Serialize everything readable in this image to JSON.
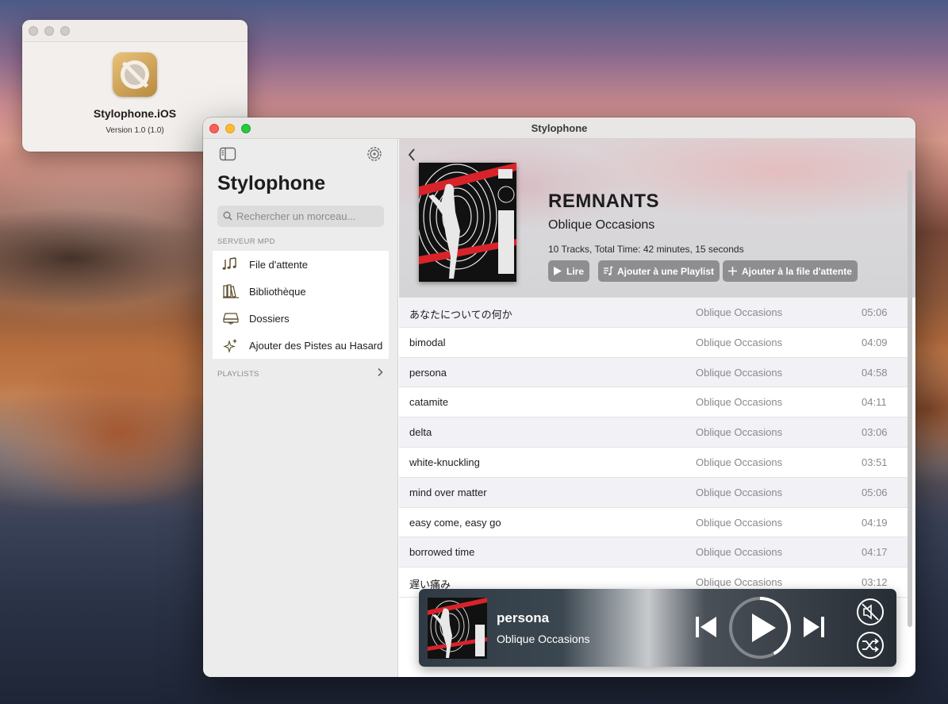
{
  "about": {
    "app_name": "Stylophone.iOS",
    "version": "Version 1.0 (1.0)"
  },
  "window": {
    "title": "Stylophone"
  },
  "sidebar": {
    "title": "Stylophone",
    "search_placeholder": "Rechercher un morceau...",
    "server_section": "SERVEUR MPD",
    "items": [
      {
        "label": "File d'attente",
        "icon": "music-notes-icon"
      },
      {
        "label": "Bibliothèque",
        "icon": "books-icon"
      },
      {
        "label": "Dossiers",
        "icon": "drive-icon"
      },
      {
        "label": "Ajouter des Pistes au Hasard",
        "icon": "sparkles-icon"
      }
    ],
    "playlists_section": "PLAYLISTS"
  },
  "album": {
    "title": "REMNANTS",
    "artist": "Oblique Occasions",
    "meta": "10 Tracks, Total Time: 42 minutes, 15 seconds",
    "buttons": {
      "play": "Lire",
      "add_playlist": "Ajouter à une Playlist",
      "add_queue": "Ajouter à la file d'attente"
    }
  },
  "tracks": [
    {
      "title": "あなたについての何か",
      "artist": "Oblique Occasions",
      "duration": "05:06"
    },
    {
      "title": "bimodal",
      "artist": "Oblique Occasions",
      "duration": "04:09"
    },
    {
      "title": "persona",
      "artist": "Oblique Occasions",
      "duration": "04:58"
    },
    {
      "title": "catamite",
      "artist": "Oblique Occasions",
      "duration": "04:11"
    },
    {
      "title": "delta",
      "artist": "Oblique Occasions",
      "duration": "03:06"
    },
    {
      "title": "white-knuckling",
      "artist": "Oblique Occasions",
      "duration": "03:51"
    },
    {
      "title": "mind over matter",
      "artist": "Oblique Occasions",
      "duration": "05:06"
    },
    {
      "title": "easy come, easy go",
      "artist": "Oblique Occasions",
      "duration": "04:19"
    },
    {
      "title": "borrowed time",
      "artist": "Oblique Occasions",
      "duration": "04:17"
    },
    {
      "title": "遅い痛み",
      "artist": "Oblique Occasions",
      "duration": "03:12"
    }
  ],
  "now_playing": {
    "title": "persona",
    "artist": "Oblique Occasions",
    "progress": 0.42
  },
  "colors": {
    "traffic_red": "#fe5f57",
    "traffic_yellow": "#febc2e",
    "traffic_green": "#28c840",
    "button_gray": "#8e8e90",
    "cover_red": "#d8232a"
  }
}
